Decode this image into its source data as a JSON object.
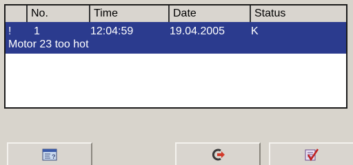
{
  "table": {
    "columns": [
      "",
      "No.",
      "Time",
      "Date",
      "Status"
    ],
    "rows": [
      {
        "flag": "!",
        "no": "1",
        "time": "12:04:59",
        "date": "19.04.2005",
        "status": "K",
        "message": "Motor 23 too hot"
      }
    ]
  },
  "colors": {
    "selected_row": "#2b3b8e",
    "background": "#d8d4cc"
  },
  "toolbar": {
    "buttons": [
      {
        "icon": "info-text-icon"
      },
      {
        "icon": "loop-in-icon"
      },
      {
        "icon": "acknowledge-icon"
      }
    ]
  }
}
